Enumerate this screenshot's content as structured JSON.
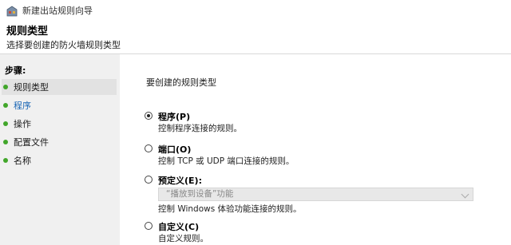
{
  "window": {
    "title": "新建出站规则向导"
  },
  "header": {
    "title": "规则类型",
    "subtitle": "选择要创建的防火墙规则类型"
  },
  "sidebar": {
    "steps_label": "步骤:",
    "items": [
      {
        "label": "规则类型"
      },
      {
        "label": "程序"
      },
      {
        "label": "操作"
      },
      {
        "label": "配置文件"
      },
      {
        "label": "名称"
      }
    ]
  },
  "main": {
    "prompt": "要创建的规则类型",
    "options": [
      {
        "label": "程序(P)",
        "description": "控制程序连接的规则。",
        "selected": true
      },
      {
        "label": "端口(O)",
        "description": "控制 TCP 或 UDP 端口连接的规则。",
        "selected": false
      },
      {
        "label": "预定义(E):",
        "select_value": "“播放到设备”功能",
        "description": "控制 Windows 体验功能连接的规则。",
        "selected": false
      },
      {
        "label": "自定义(C)",
        "description": "自定义规则。",
        "selected": false
      }
    ]
  },
  "colors": {
    "step_dot": "#41a62a",
    "link": "#1a66b5",
    "sidebar_bg": "#f0f0f0"
  }
}
